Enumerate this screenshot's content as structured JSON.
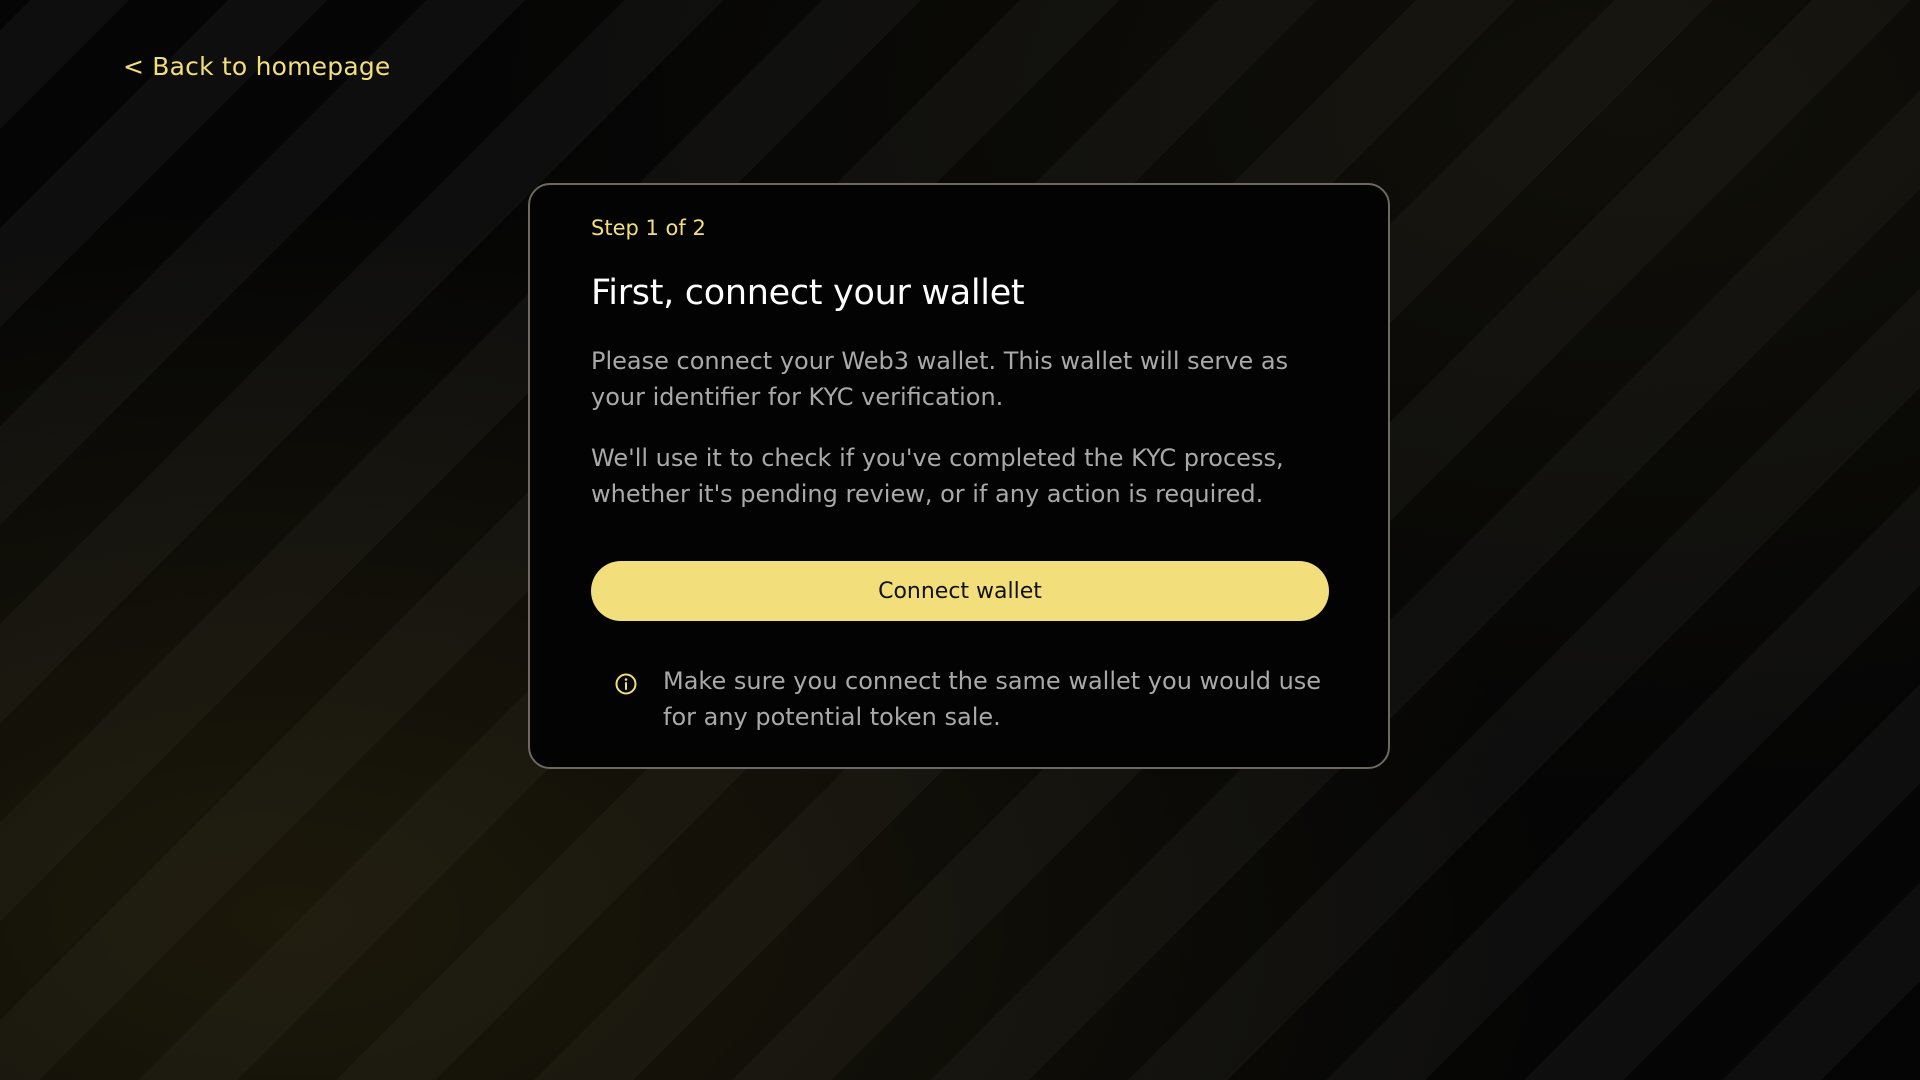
{
  "nav": {
    "back_label": "< Back to homepage"
  },
  "card": {
    "step_label": "Step 1 of 2",
    "title": "First, connect your wallet",
    "paragraph_1": "Please connect your Web3 wallet. This wallet will serve as your identifier for KYC verification.",
    "paragraph_2": "We'll use it to check if you've completed the KYC process, whether it's pending review, or if any action is required.",
    "connect_button_label": "Connect wallet",
    "note_icon": "info-icon",
    "note_text": "Make sure you connect the same wallet you would use for any potential token sale."
  },
  "colors": {
    "accent": "#f3de7c",
    "background": "#000000",
    "card_border": "#6d6860",
    "body_text": "#a9a9a9",
    "title_text": "#ffffff"
  }
}
